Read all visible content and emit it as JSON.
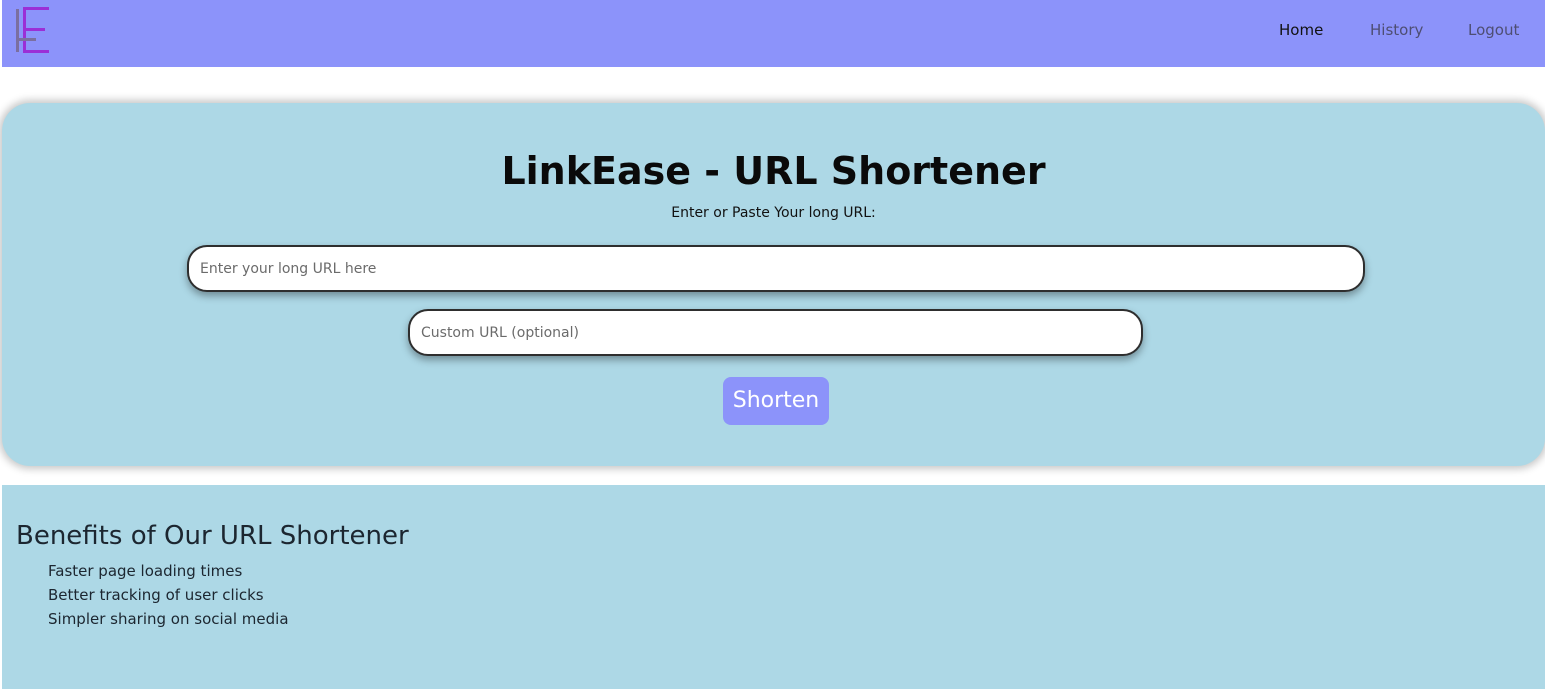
{
  "navbar": {
    "logo_icon": "bracket-e-logo-icon",
    "links": [
      {
        "label": "Home",
        "active": true
      },
      {
        "label": "History",
        "active": false
      },
      {
        "label": "Logout",
        "active": false
      }
    ]
  },
  "hero": {
    "title": "LinkEase - URL Shortener",
    "subtitle": "Enter or Paste Your long URL:",
    "long_url": {
      "value": "",
      "placeholder": "Enter your long URL here"
    },
    "custom_url": {
      "value": "",
      "placeholder": "Custom URL (optional)"
    },
    "shorten_label": "Shorten"
  },
  "benefits": {
    "title": "Benefits of Our URL Shortener",
    "items": [
      "Faster page loading times",
      "Better tracking of user clicks",
      "Simpler sharing on social media"
    ]
  },
  "colors": {
    "navbar_bg": "#8c93fa",
    "card_bg": "#add8e6",
    "button_bg": "#8c93fa",
    "logo_purple": "#9b2fd6",
    "logo_gray": "#7b6fa0"
  }
}
